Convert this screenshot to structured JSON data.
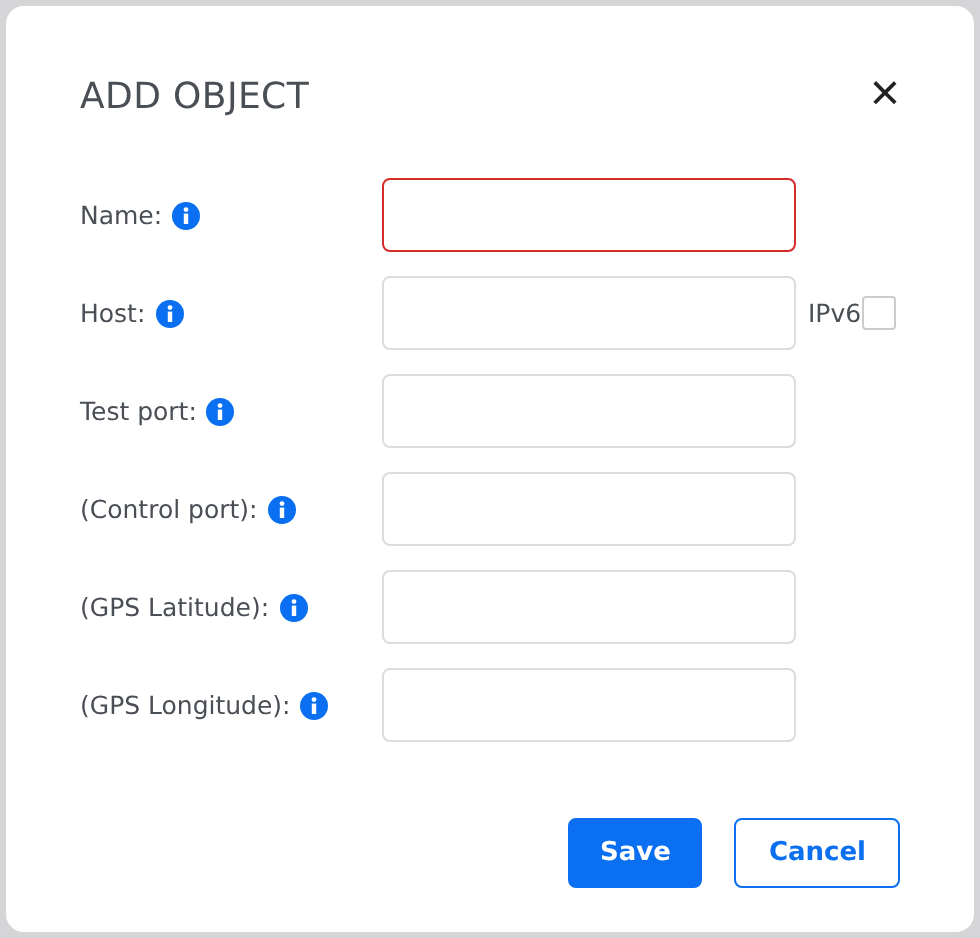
{
  "dialog": {
    "title": "ADD OBJECT",
    "close": "×"
  },
  "fields": [
    {
      "label": "Name:",
      "invalid": true
    },
    {
      "label": "Host:",
      "invalid": false,
      "checkbox": {
        "label": "IPv6",
        "checked": false
      }
    },
    {
      "label": "Test port:",
      "invalid": false
    },
    {
      "label": "(Control port):",
      "invalid": false
    },
    {
      "label": "(GPS Latitude):",
      "invalid": false
    },
    {
      "label": "(GPS Longitude):",
      "invalid": false
    }
  ],
  "buttons": [
    {
      "label": "Save",
      "kind": "primary"
    },
    {
      "label": "Cancel",
      "kind": "secondary"
    }
  ]
}
